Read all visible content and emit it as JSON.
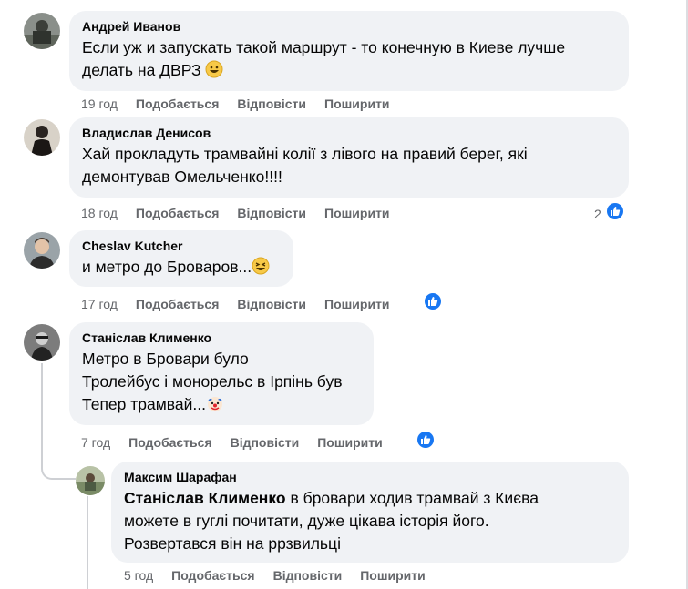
{
  "actions": {
    "like": "Подобається",
    "reply": "Відповісти",
    "share": "Поширити"
  },
  "colors": {
    "bubble": "#f0f2f5",
    "meta": "#65676b",
    "like_blue": "#1877f2",
    "text": "#050505"
  },
  "comments": [
    {
      "author": "Андрей Иванов",
      "lines": [
        "Если уж и запускать такой маршрут - то конечную в Киеве лучше",
        "делать на ДВРЗ"
      ],
      "emoji": "grinning-face",
      "time": "19 год"
    },
    {
      "author": "Владислав Денисов",
      "lines": [
        "Хай прокладуть трамвайні колії з лівого на правий берег, які",
        "демонтував Омельченко!!!!"
      ],
      "time": "18 год",
      "reaction_count": "2"
    },
    {
      "author": "Cheslav Kutcher",
      "lines": [
        "и метро до Броваров..."
      ],
      "emoji": "laughing-face",
      "time": "17 год"
    },
    {
      "author": "Станіслав Клименко",
      "lines": [
        "Метро в Бровари було",
        "Тролейбус і монорельс в Ірпінь був",
        "Тепер трамвай..."
      ],
      "emoji": "clown-face",
      "time": "7 год"
    },
    {
      "author": "Максим Шарафан",
      "mention": "Станіслав Клименко",
      "lines": [
        " в бровари ходив трамвай з Києва",
        "можете в гуглі почитати, дуже цікава історія його.",
        "Розвертався він на ррзвильці"
      ],
      "time": "5 год"
    }
  ]
}
